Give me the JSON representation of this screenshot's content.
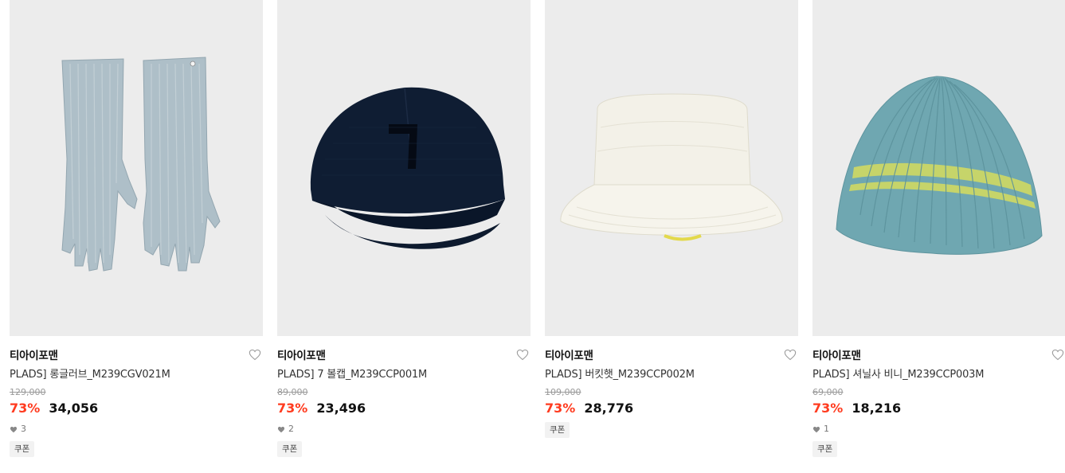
{
  "products": [
    {
      "image": "long-gloves-light-blue",
      "brand": "티아이포맨",
      "title": "PLADS] 롱글러브_M239CGV021M",
      "original_price": "129,000",
      "discount": "73%",
      "price": "34,056",
      "likes": "3",
      "coupon": "쿠폰"
    },
    {
      "image": "navy-ball-cap",
      "brand": "티아이포맨",
      "title": "PLADS] 7 볼캡_M239CCP001M",
      "original_price": "89,000",
      "discount": "73%",
      "price": "23,496",
      "likes": "2",
      "coupon": "쿠폰"
    },
    {
      "image": "white-fleece-bucket-hat",
      "brand": "티아이포맨",
      "title": "PLADS] 버킷햇_M239CCP002M",
      "original_price": "109,000",
      "discount": "73%",
      "price": "28,776",
      "likes": null,
      "coupon": "쿠폰"
    },
    {
      "image": "teal-chenille-beanie",
      "brand": "티아이포맨",
      "title": "PLADS] 셔닐사 비니_M239CCP003M",
      "original_price": "69,000",
      "discount": "73%",
      "price": "18,216",
      "likes": "1",
      "coupon": "쿠폰"
    }
  ],
  "colors": {
    "discount": "#ff3b1f",
    "image_bg": "#ececec"
  },
  "icons": {
    "wishlist": "heart-outline-icon",
    "like_count": "heart-filled-icon"
  }
}
